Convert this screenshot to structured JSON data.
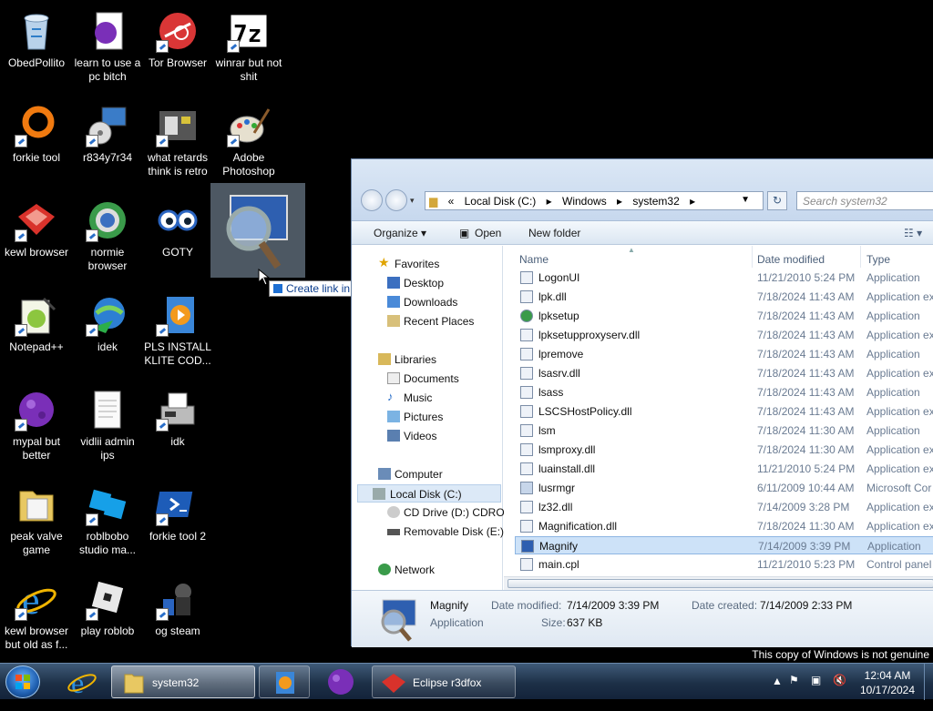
{
  "desktop": {
    "icons": [
      {
        "label": "ObedPollito"
      },
      {
        "label": "learn to use a pc bitch"
      },
      {
        "label": "Tor Browser"
      },
      {
        "label": "winrar but not shit"
      },
      {
        "label": "forkie tool"
      },
      {
        "label": "r834y7r34"
      },
      {
        "label": "what retards think is retro"
      },
      {
        "label": "Adobe Photoshop"
      },
      {
        "label": "kewl browser"
      },
      {
        "label": "normie browser"
      },
      {
        "label": "GOTY"
      },
      {
        "label": "Notepad++"
      },
      {
        "label": "idek"
      },
      {
        "label": "PLS INSTALL KLITE COD..."
      },
      {
        "label": "mypal but better"
      },
      {
        "label": "vidlii admin ips"
      },
      {
        "label": "idk"
      },
      {
        "label": "peak valve game"
      },
      {
        "label": "roblbobo studio ma..."
      },
      {
        "label": "forkie tool 2"
      },
      {
        "label": "kewl browser but old as f..."
      },
      {
        "label": "play roblob"
      },
      {
        "label": "og steam"
      }
    ],
    "winrar_glyph": "7z",
    "drag_tooltip": "Create link in Desktop",
    "watermark": "This copy of Windows is not genuine"
  },
  "explorer": {
    "breadcrumb": {
      "prefix": "«",
      "parts": [
        "Local Disk (C:)",
        "Windows",
        "system32"
      ]
    },
    "search_placeholder": "Search system32",
    "toolbar": {
      "organize": "Organize ▾",
      "open": "Open",
      "new_folder": "New folder"
    },
    "nav": {
      "favorites": "Favorites",
      "desktop": "Desktop",
      "downloads": "Downloads",
      "recent": "Recent Places",
      "libraries": "Libraries",
      "documents": "Documents",
      "music": "Music",
      "pictures": "Pictures",
      "videos": "Videos",
      "computer": "Computer",
      "local_disk": "Local Disk (C:)",
      "cd_drive": "CD Drive (D:) CDROM",
      "removable": "Removable Disk (E:)",
      "network": "Network"
    },
    "columns": {
      "name": "Name",
      "date": "Date modified",
      "type": "Type"
    },
    "rows": [
      {
        "name": "LogonUI",
        "date": "11/21/2010 5:24 PM",
        "type": "Application"
      },
      {
        "name": "lpk.dll",
        "date": "7/18/2024 11:43 AM",
        "type": "Application ex"
      },
      {
        "name": "lpksetup",
        "date": "7/18/2024 11:43 AM",
        "type": "Application"
      },
      {
        "name": "lpksetupproxyserv.dll",
        "date": "7/18/2024 11:43 AM",
        "type": "Application ex"
      },
      {
        "name": "lpremove",
        "date": "7/18/2024 11:43 AM",
        "type": "Application"
      },
      {
        "name": "lsasrv.dll",
        "date": "7/18/2024 11:43 AM",
        "type": "Application ex"
      },
      {
        "name": "lsass",
        "date": "7/18/2024 11:43 AM",
        "type": "Application"
      },
      {
        "name": "LSCSHostPolicy.dll",
        "date": "7/18/2024 11:43 AM",
        "type": "Application ex"
      },
      {
        "name": "lsm",
        "date": "7/18/2024 11:30 AM",
        "type": "Application"
      },
      {
        "name": "lsmproxy.dll",
        "date": "7/18/2024 11:30 AM",
        "type": "Application ex"
      },
      {
        "name": "luainstall.dll",
        "date": "11/21/2010 5:24 PM",
        "type": "Application ex"
      },
      {
        "name": "lusrmgr",
        "date": "6/11/2009 10:44 AM",
        "type": "Microsoft Cor"
      },
      {
        "name": "lz32.dll",
        "date": "7/14/2009 3:28 PM",
        "type": "Application ex"
      },
      {
        "name": "Magnification.dll",
        "date": "7/18/2024 11:30 AM",
        "type": "Application ex"
      },
      {
        "name": "Magnify",
        "date": "7/14/2009 3:39 PM",
        "type": "Application"
      },
      {
        "name": "main.cpl",
        "date": "11/21/2010 5:23 PM",
        "type": "Control panel"
      }
    ],
    "details": {
      "name": "Magnify",
      "kind": "Application",
      "modified_label": "Date modified:",
      "modified": "7/14/2009 3:39 PM",
      "created_label": "Date created:",
      "created": "7/14/2009 2:33 PM",
      "size_label": "Size:",
      "size": "637 KB"
    }
  },
  "taskbar": {
    "system32": "system32",
    "eclipse": "Eclipse r3dfox",
    "time": "12:04 AM",
    "date": "10/17/2024"
  }
}
